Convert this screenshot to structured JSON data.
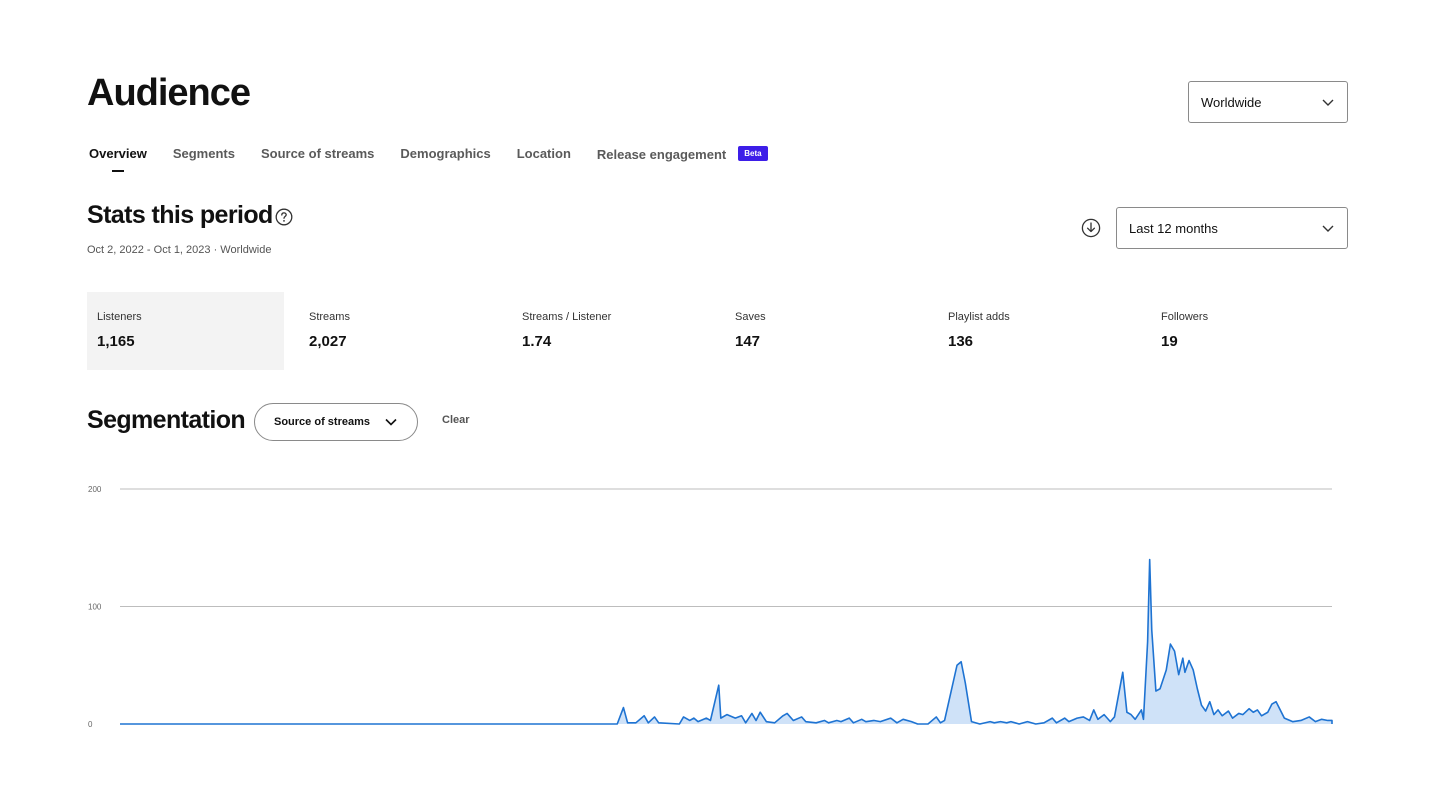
{
  "header": {
    "title": "Audience"
  },
  "region_select": {
    "value": "Worldwide"
  },
  "tabs": [
    {
      "label": "Overview",
      "active": true
    },
    {
      "label": "Segments"
    },
    {
      "label": "Source of streams"
    },
    {
      "label": "Demographics"
    },
    {
      "label": "Location"
    },
    {
      "label": "Release engagement",
      "badge": "Beta"
    }
  ],
  "stats": {
    "title": "Stats this period",
    "date_range": "Oct 2, 2022 - Oct 1, 2023 · Worldwide",
    "period_select": "Last 12 months"
  },
  "metrics": [
    {
      "label": "Listeners",
      "value": "1,165",
      "active": true
    },
    {
      "label": "Streams",
      "value": "2,027"
    },
    {
      "label": "Streams / Listener",
      "value": "1.74"
    },
    {
      "label": "Saves",
      "value": "147"
    },
    {
      "label": "Playlist adds",
      "value": "136"
    },
    {
      "label": "Followers",
      "value": "19"
    }
  ],
  "segmentation": {
    "title": "Segmentation",
    "select_value": "Source of streams",
    "clear_label": "Clear"
  },
  "icons": {
    "help": "help-circle-icon",
    "download": "download-icon",
    "chevron": "chevron-down-icon"
  },
  "colors": {
    "line": "#1e73d2",
    "fill": "#cfe2f8",
    "beta": "#3d1ee8",
    "grid": "#bdbdbd"
  },
  "chart_data": {
    "type": "area",
    "ylim": [
      0,
      200
    ],
    "yticks": [
      0,
      100,
      200
    ],
    "grid": true,
    "n_points": 365,
    "points": [
      [
        0,
        0
      ],
      [
        240,
        0
      ],
      [
        243,
        14
      ],
      [
        245,
        1
      ],
      [
        249,
        1
      ],
      [
        253,
        7
      ],
      [
        255,
        1
      ],
      [
        258,
        6
      ],
      [
        260,
        1
      ],
      [
        270,
        0
      ],
      [
        272,
        6
      ],
      [
        275,
        3
      ],
      [
        277,
        5
      ],
      [
        279,
        2
      ],
      [
        283,
        5
      ],
      [
        285,
        3
      ],
      [
        289,
        33
      ],
      [
        290,
        5
      ],
      [
        293,
        8
      ],
      [
        297,
        5
      ],
      [
        300,
        7
      ],
      [
        302,
        1
      ],
      [
        305,
        9
      ],
      [
        307,
        3
      ],
      [
        309,
        10
      ],
      [
        312,
        2
      ],
      [
        316,
        1
      ],
      [
        320,
        7
      ],
      [
        322,
        9
      ],
      [
        325,
        3
      ],
      [
        329,
        6
      ],
      [
        331,
        2
      ],
      [
        336,
        1
      ],
      [
        340,
        3
      ],
      [
        342,
        1
      ],
      [
        346,
        3
      ],
      [
        348,
        2
      ],
      [
        352,
        5
      ],
      [
        354,
        1
      ],
      [
        358,
        4
      ],
      [
        360,
        2
      ],
      [
        364,
        3
      ],
      [
        367,
        2
      ],
      [
        372,
        5
      ],
      [
        375,
        1
      ],
      [
        378,
        4
      ],
      [
        382,
        2
      ],
      [
        385,
        0
      ],
      [
        390,
        0
      ],
      [
        394,
        6
      ],
      [
        396,
        1
      ],
      [
        398,
        3
      ],
      [
        404,
        50
      ],
      [
        406,
        53
      ],
      [
        408,
        35
      ],
      [
        411,
        2
      ],
      [
        415,
        0
      ],
      [
        420,
        2
      ],
      [
        422,
        1
      ],
      [
        425,
        2
      ],
      [
        428,
        1
      ],
      [
        430,
        2
      ],
      [
        434,
        0
      ],
      [
        438,
        2
      ],
      [
        442,
        0
      ],
      [
        446,
        1
      ],
      [
        450,
        5
      ],
      [
        452,
        1
      ],
      [
        456,
        5
      ],
      [
        458,
        2
      ],
      [
        462,
        5
      ],
      [
        465,
        6
      ],
      [
        468,
        3
      ],
      [
        470,
        12
      ],
      [
        472,
        4
      ],
      [
        475,
        8
      ],
      [
        478,
        2
      ],
      [
        480,
        6
      ],
      [
        484,
        44
      ],
      [
        486,
        10
      ],
      [
        488,
        8
      ],
      [
        490,
        4
      ],
      [
        493,
        12
      ],
      [
        494,
        4
      ],
      [
        496,
        70
      ],
      [
        497,
        140
      ],
      [
        498,
        80
      ],
      [
        500,
        28
      ],
      [
        502,
        30
      ],
      [
        505,
        46
      ],
      [
        507,
        68
      ],
      [
        509,
        62
      ],
      [
        511,
        42
      ],
      [
        513,
        56
      ],
      [
        514,
        44
      ],
      [
        516,
        54
      ],
      [
        518,
        46
      ],
      [
        520,
        30
      ],
      [
        522,
        16
      ],
      [
        524,
        11
      ],
      [
        526,
        19
      ],
      [
        528,
        8
      ],
      [
        530,
        12
      ],
      [
        532,
        7
      ],
      [
        535,
        11
      ],
      [
        537,
        5
      ],
      [
        540,
        9
      ],
      [
        542,
        8
      ],
      [
        545,
        13
      ],
      [
        547,
        10
      ],
      [
        549,
        12
      ],
      [
        551,
        7
      ],
      [
        554,
        10
      ],
      [
        556,
        17
      ],
      [
        558,
        19
      ],
      [
        560,
        12
      ],
      [
        562,
        5
      ],
      [
        566,
        2
      ],
      [
        570,
        3
      ],
      [
        574,
        6
      ],
      [
        577,
        2
      ],
      [
        580,
        4
      ],
      [
        583,
        3
      ],
      [
        585,
        3
      ],
      [
        585,
        0
      ]
    ]
  }
}
